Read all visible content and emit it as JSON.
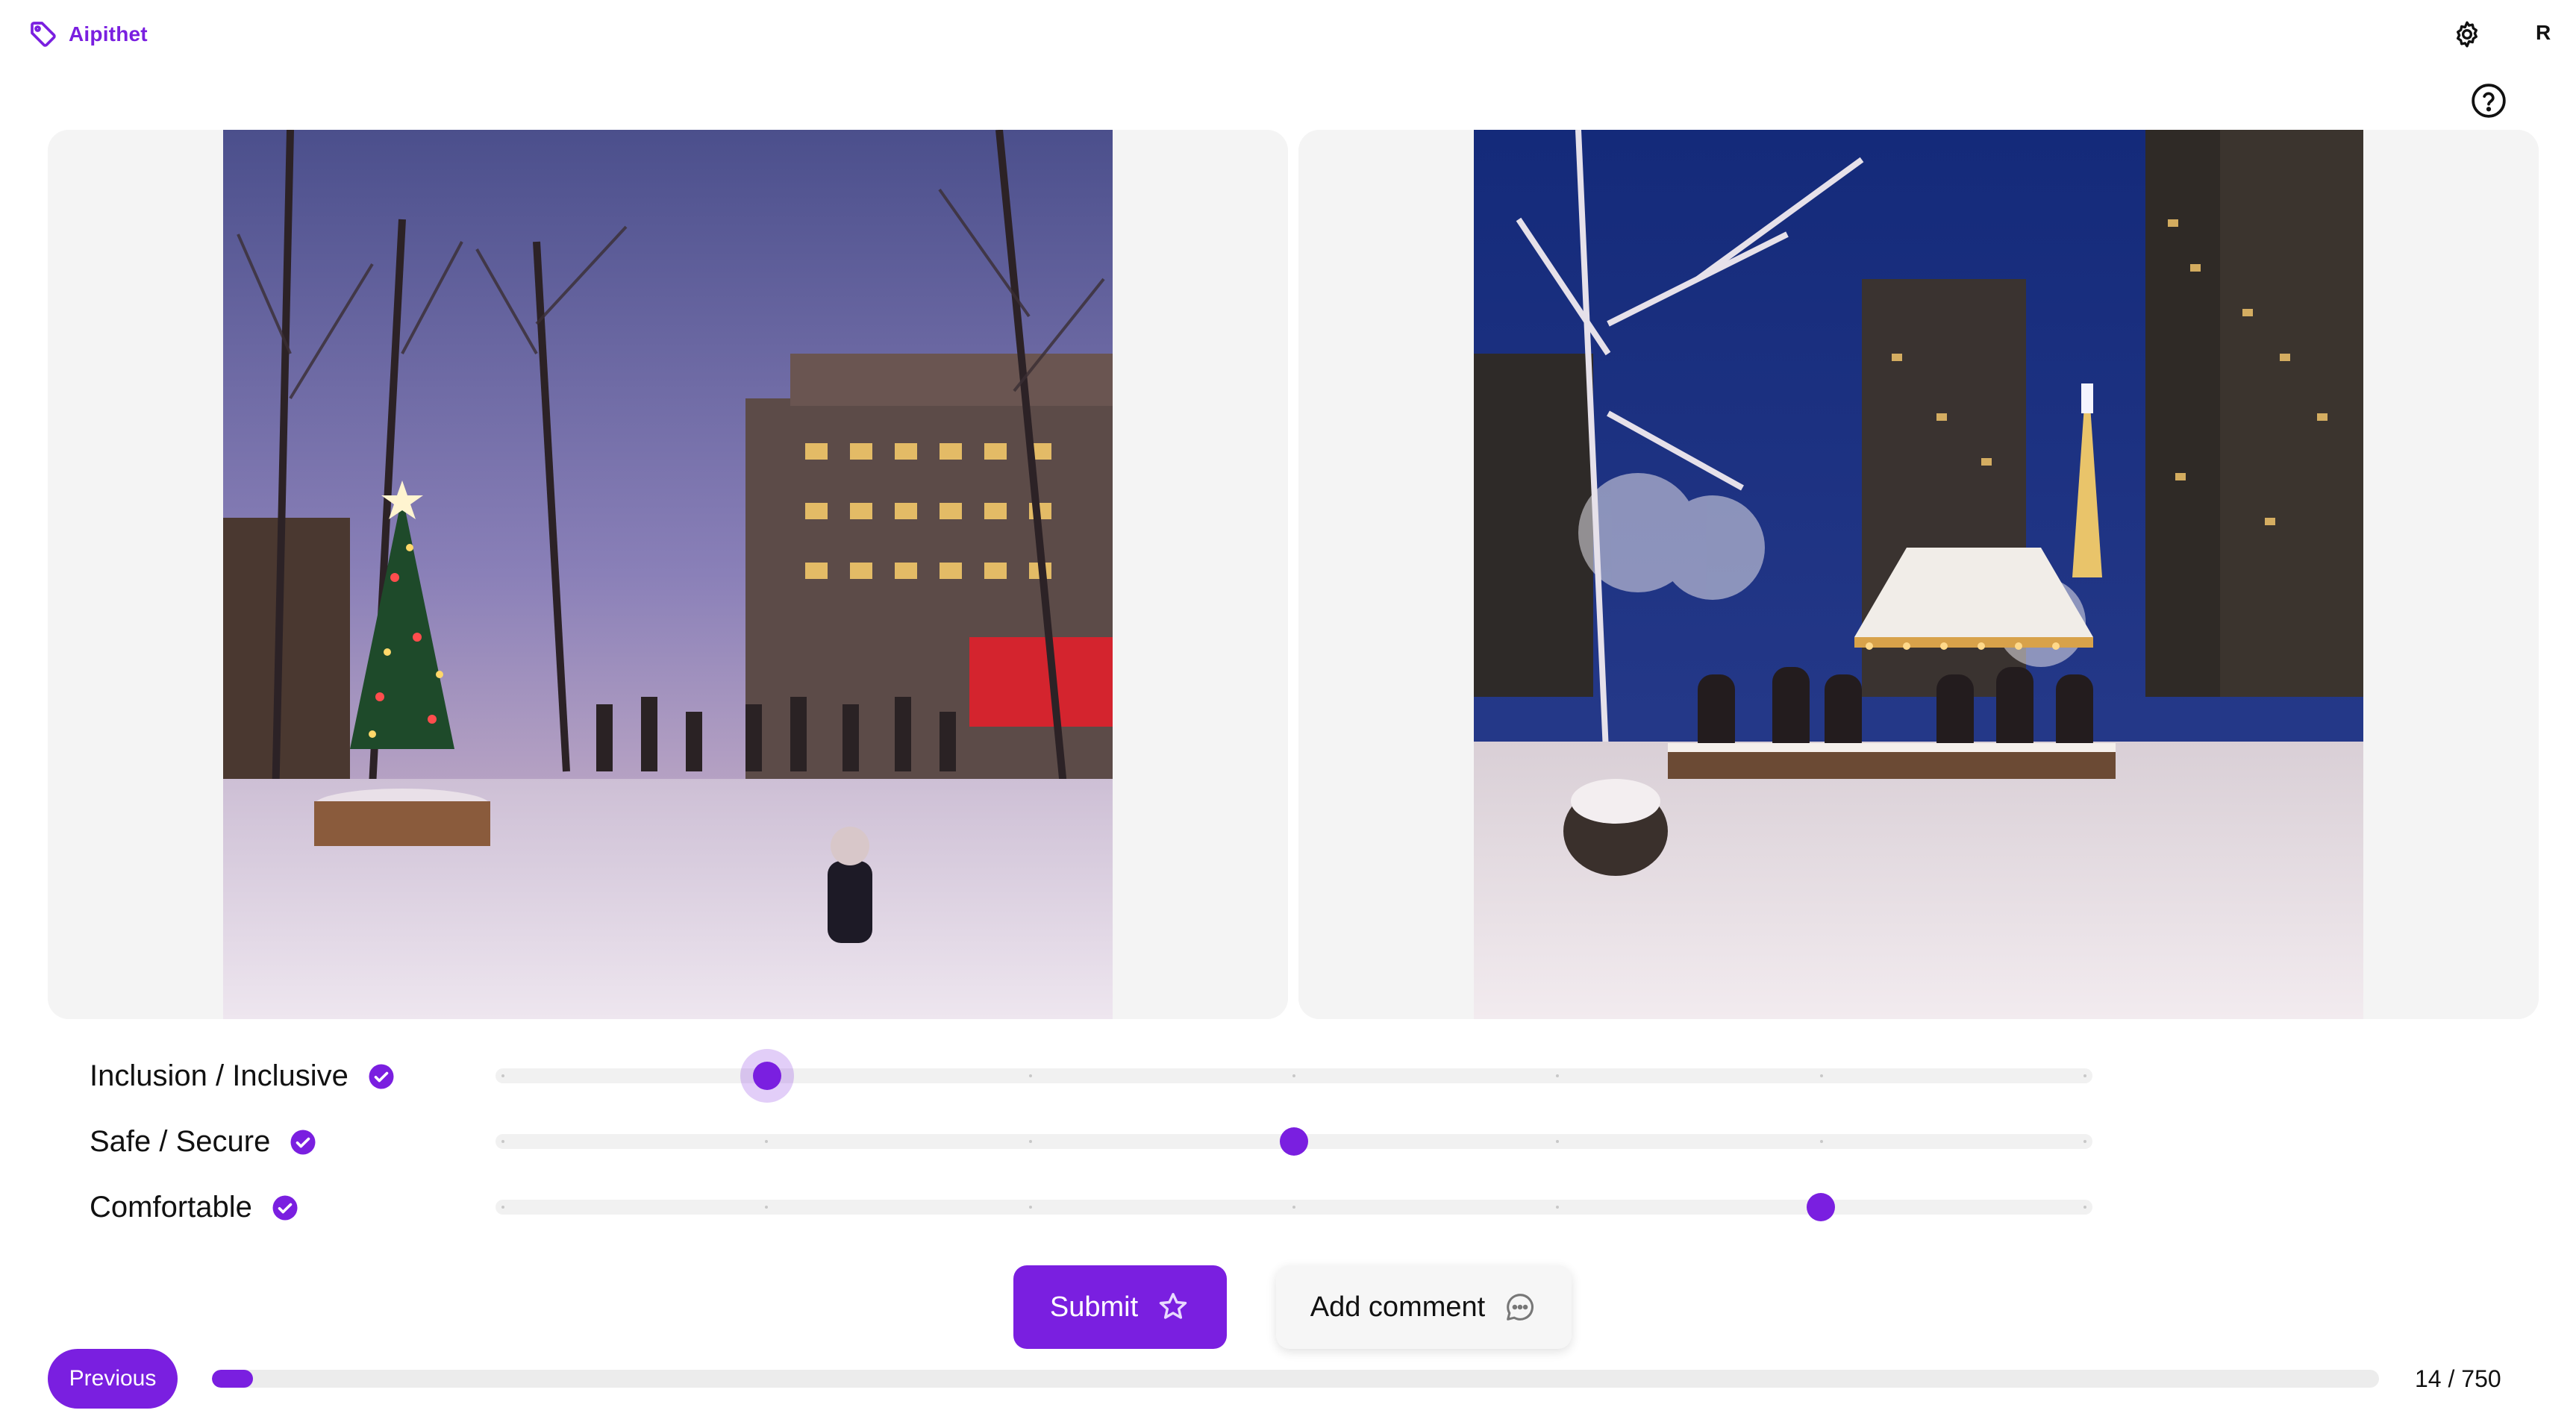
{
  "header": {
    "brand": "Aipithet",
    "avatar_initial": "R",
    "brand_color": "#7a1fe0"
  },
  "icons": {
    "brand": "tag-icon",
    "settings": "gear-icon",
    "help": "help-circle-icon",
    "check": "check-circle-icon",
    "submit": "star-icon",
    "comment": "chat-bubble-icon"
  },
  "images": {
    "left": "snowy park at night with decorated christmas tree and ice skaters",
    "right": "snowy city plaza at night with people seated under a lit canopy"
  },
  "criteria": [
    {
      "label": "Inclusion / Inclusive",
      "value": 0.17,
      "active": true
    },
    {
      "label": "Safe / Secure",
      "value": 0.5,
      "active": false
    },
    {
      "label": "Comfortable",
      "value": 0.83,
      "active": false
    }
  ],
  "slider": {
    "ticks": 7
  },
  "actions": {
    "submit_label": "Submit",
    "comment_label": "Add comment"
  },
  "footer": {
    "previous_label": "Previous",
    "counter": "14 / 750",
    "progress": 0.0187
  }
}
